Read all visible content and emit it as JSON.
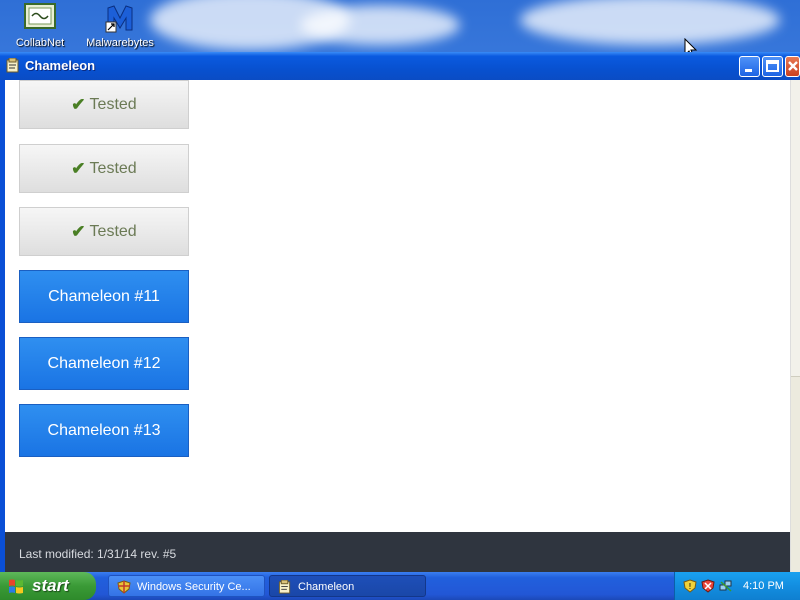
{
  "desktop": {
    "icons": [
      {
        "label": "CollabNet",
        "icon": "collabnet-icon"
      },
      {
        "label": "Malwarebytes",
        "icon": "malwarebytes-icon"
      }
    ]
  },
  "window": {
    "title": "Chameleon",
    "controls": {
      "minimize": "minimize-icon",
      "maximize": "maximize-icon",
      "close": "close-icon"
    }
  },
  "content": {
    "tested_buttons": [
      {
        "label": "Tested",
        "icon": "checkmark-icon"
      },
      {
        "label": "Tested",
        "icon": "checkmark-icon"
      },
      {
        "label": "Tested",
        "icon": "checkmark-icon"
      }
    ],
    "chameleon_buttons": [
      {
        "label": "Chameleon #11"
      },
      {
        "label": "Chameleon #12"
      },
      {
        "label": "Chameleon #13"
      }
    ],
    "footer": {
      "text": "Last modified: 1/31/14 rev. #5"
    }
  },
  "taskbar": {
    "start_label": "start",
    "tasks": [
      {
        "label": "Windows Security Ce...",
        "icon": "security-center-icon"
      },
      {
        "label": "Chameleon",
        "icon": "chameleon-app-icon"
      }
    ],
    "clock": "4:10 PM"
  },
  "colors": {
    "accent": "#1a74e4",
    "tested_text": "#6b7a55",
    "check": "#4a7f25",
    "footer_bg": "#2f353f"
  }
}
